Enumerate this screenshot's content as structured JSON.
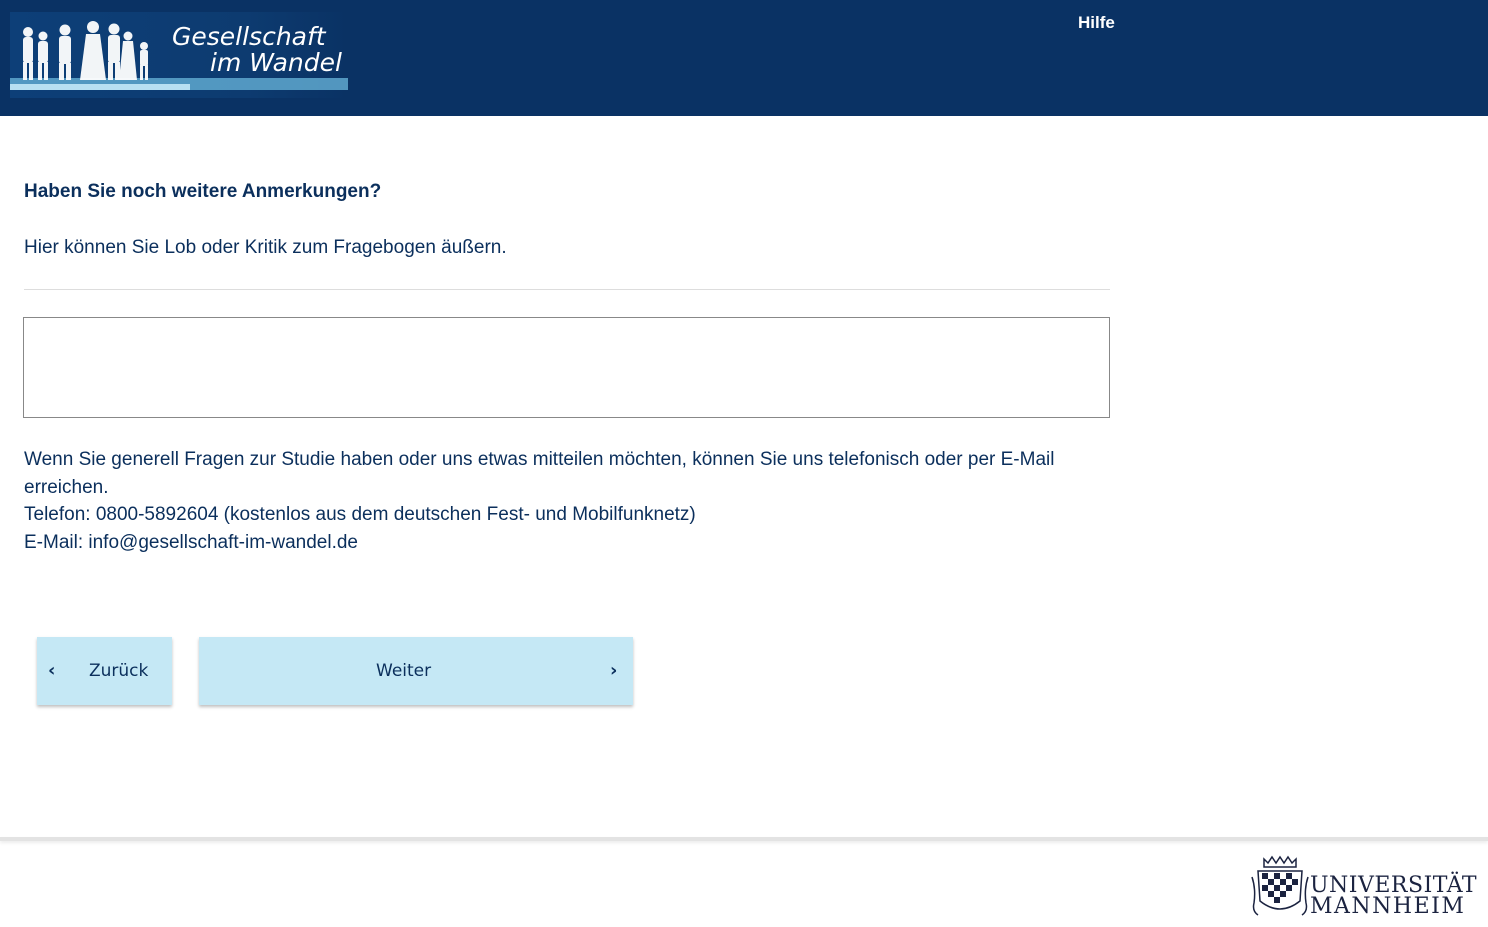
{
  "header": {
    "logo_line1": "Gesellschaft",
    "logo_line2": "im Wandel",
    "help_label": "Hilfe",
    "background_color": "#0a3264"
  },
  "question": {
    "title": "Haben Sie noch weitere Anmerkungen?",
    "subtitle": "Hier können Sie Lob oder Kritik zum Fragebogen äußern.",
    "comment_value": ""
  },
  "contact": {
    "line1": "Wenn Sie generell Fragen zur Studie haben oder uns etwas mitteilen möchten, können Sie uns telefonisch oder per E-Mail",
    "line2": "erreichen.",
    "phone": "Telefon: 0800-5892604 (kostenlos aus dem deutschen Fest- und Mobilfunknetz)",
    "email": "E-Mail: info@gesellschaft-im-wandel.de"
  },
  "navigation": {
    "back_label": "Zurück",
    "next_label": "Weiter",
    "button_color": "#c5e8f5"
  },
  "footer": {
    "university_line1": "UNIVERSITÄT",
    "university_line2": "MANNHEIM"
  }
}
